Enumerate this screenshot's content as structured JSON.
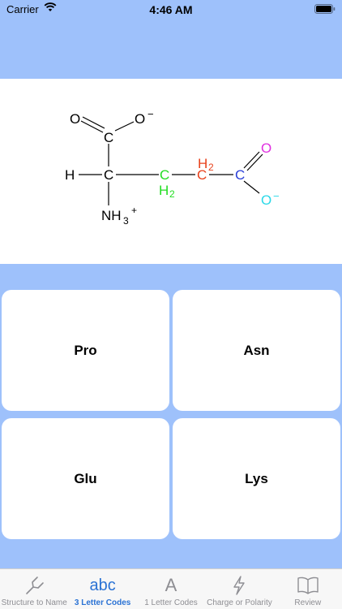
{
  "status_bar": {
    "carrier": "Carrier",
    "time": "4:46 AM"
  },
  "structure": {
    "atoms": {
      "o_top": "O",
      "o_minus": "O",
      "minus_1": "−",
      "c_carboxyl": "C",
      "h": "H",
      "c_alpha": "C",
      "nh": "NH",
      "sub_3": "3",
      "plus": "+",
      "c_green": "C",
      "h2_green": "H",
      "sub_2_green": "2",
      "h2_red": "H",
      "sub_2_red": "2",
      "c_red": "C",
      "c_blue": "C",
      "o_magenta": "O",
      "o_cyan": "O",
      "minus_2": "−"
    },
    "colors": {
      "black": "#000000",
      "green": "#22dd22",
      "red": "#e8421c",
      "blue": "#2a3fd8",
      "magenta": "#e030e0",
      "cyan": "#2ad8e8"
    }
  },
  "choices": [
    "Pro",
    "Asn",
    "Glu",
    "Lys"
  ],
  "tabs": [
    {
      "label": "Structure to Name",
      "icon": "tuning-fork-icon",
      "active": false
    },
    {
      "label": "3 Letter Codes",
      "icon": "abc-icon",
      "glyph": "abc",
      "active": true
    },
    {
      "label": "1 Letter Codes",
      "icon": "letter-a-icon",
      "glyph": "A",
      "active": false
    },
    {
      "label": "Charge or Polarity",
      "icon": "lightning-icon",
      "active": false
    },
    {
      "label": "Review",
      "icon": "book-icon",
      "active": false
    }
  ],
  "theme": {
    "background": "#9ec1fb",
    "active_tab": "#2a72d4"
  }
}
